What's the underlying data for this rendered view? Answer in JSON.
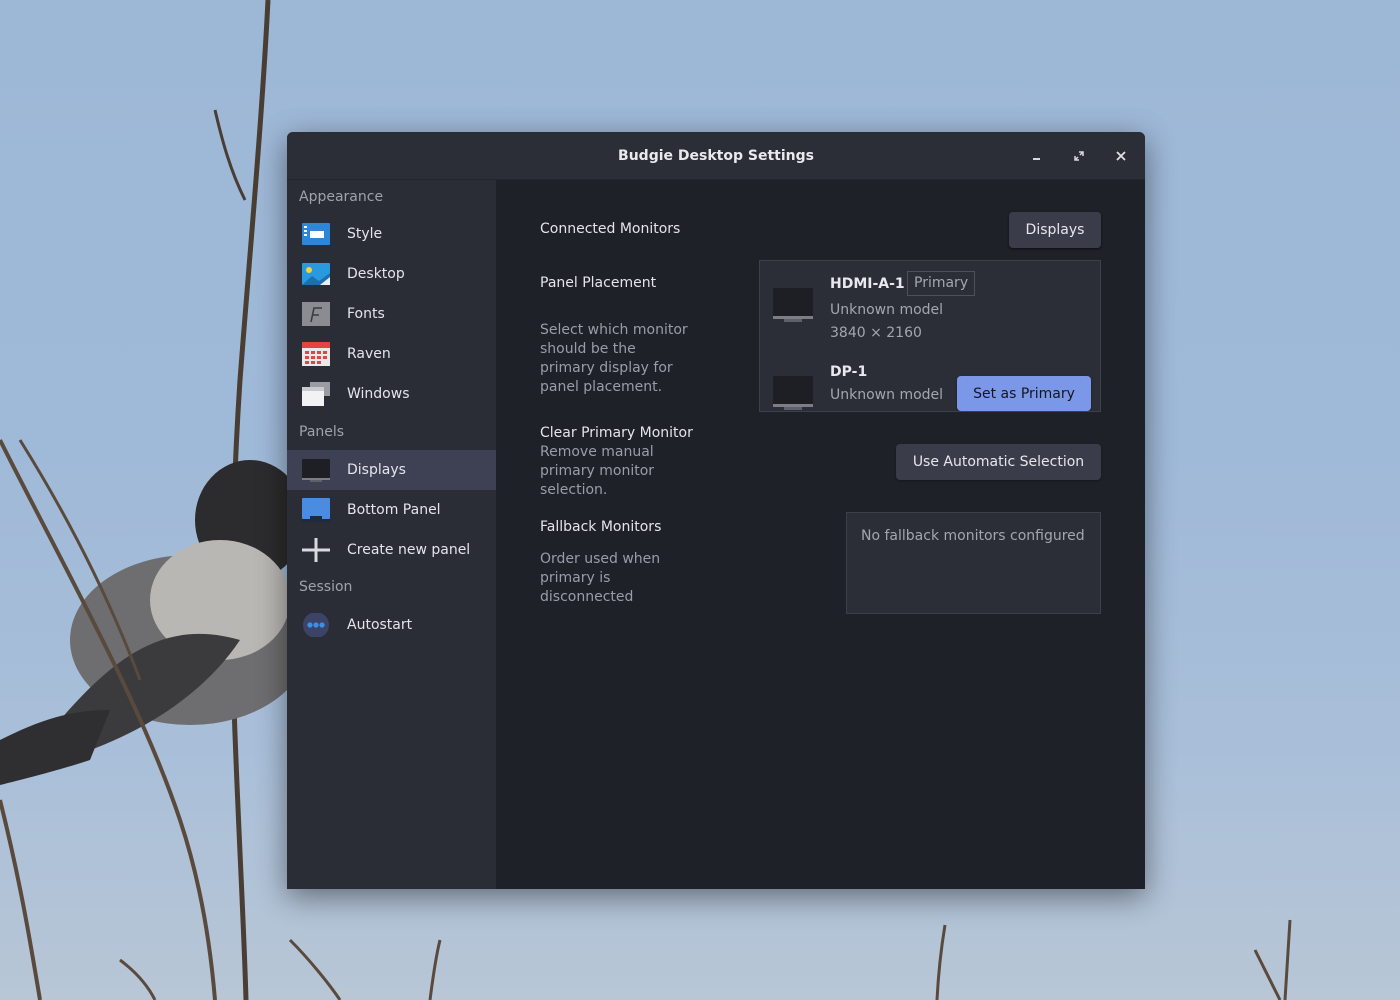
{
  "window": {
    "title": "Budgie Desktop Settings",
    "controls": {
      "minimize": "minimize-icon",
      "maximize": "maximize-icon",
      "close": "close-icon"
    }
  },
  "sidebar": {
    "sections": [
      {
        "label": "Appearance"
      },
      {
        "label": "Panels"
      },
      {
        "label": "Session"
      }
    ],
    "items": [
      {
        "label": "Style",
        "icon": "style-icon"
      },
      {
        "label": "Desktop",
        "icon": "desktop-icon"
      },
      {
        "label": "Fonts",
        "icon": "fonts-icon"
      },
      {
        "label": "Raven",
        "icon": "raven-icon"
      },
      {
        "label": "Windows",
        "icon": "windows-icon"
      },
      {
        "label": "Displays",
        "icon": "displays-icon",
        "active": true
      },
      {
        "label": "Bottom Panel",
        "icon": "bottom-panel-icon"
      },
      {
        "label": "Create new panel",
        "icon": "add-icon"
      },
      {
        "label": "Autostart",
        "icon": "autostart-icon"
      }
    ]
  },
  "content": {
    "connected_monitors": {
      "label": "Connected Monitors",
      "button": "Displays"
    },
    "panel_placement": {
      "label": "Panel Placement",
      "description_lines": [
        "Select which monitor",
        "should be the",
        "primary display for",
        "panel placement."
      ]
    },
    "monitors": [
      {
        "name": "HDMI-A-1",
        "badge": "Primary",
        "model": "Unknown model",
        "resolution": "3840 × 2160"
      },
      {
        "name": "DP-1",
        "model": "Unknown model",
        "button": "Set as Primary"
      }
    ],
    "clear_primary": {
      "label": "Clear Primary Monitor",
      "description_lines": [
        "Remove manual",
        "primary monitor",
        "selection."
      ],
      "button": "Use Automatic Selection"
    },
    "fallback": {
      "label": "Fallback Monitors",
      "description_lines": [
        "Order used when",
        "primary is",
        "disconnected"
      ],
      "empty_text": "No fallback monitors configured"
    }
  },
  "colors": {
    "accent": "#7a97e8",
    "window_bg": "#1f2129",
    "sidebar_bg": "#2b2d36",
    "active_item": "#3e4154"
  }
}
